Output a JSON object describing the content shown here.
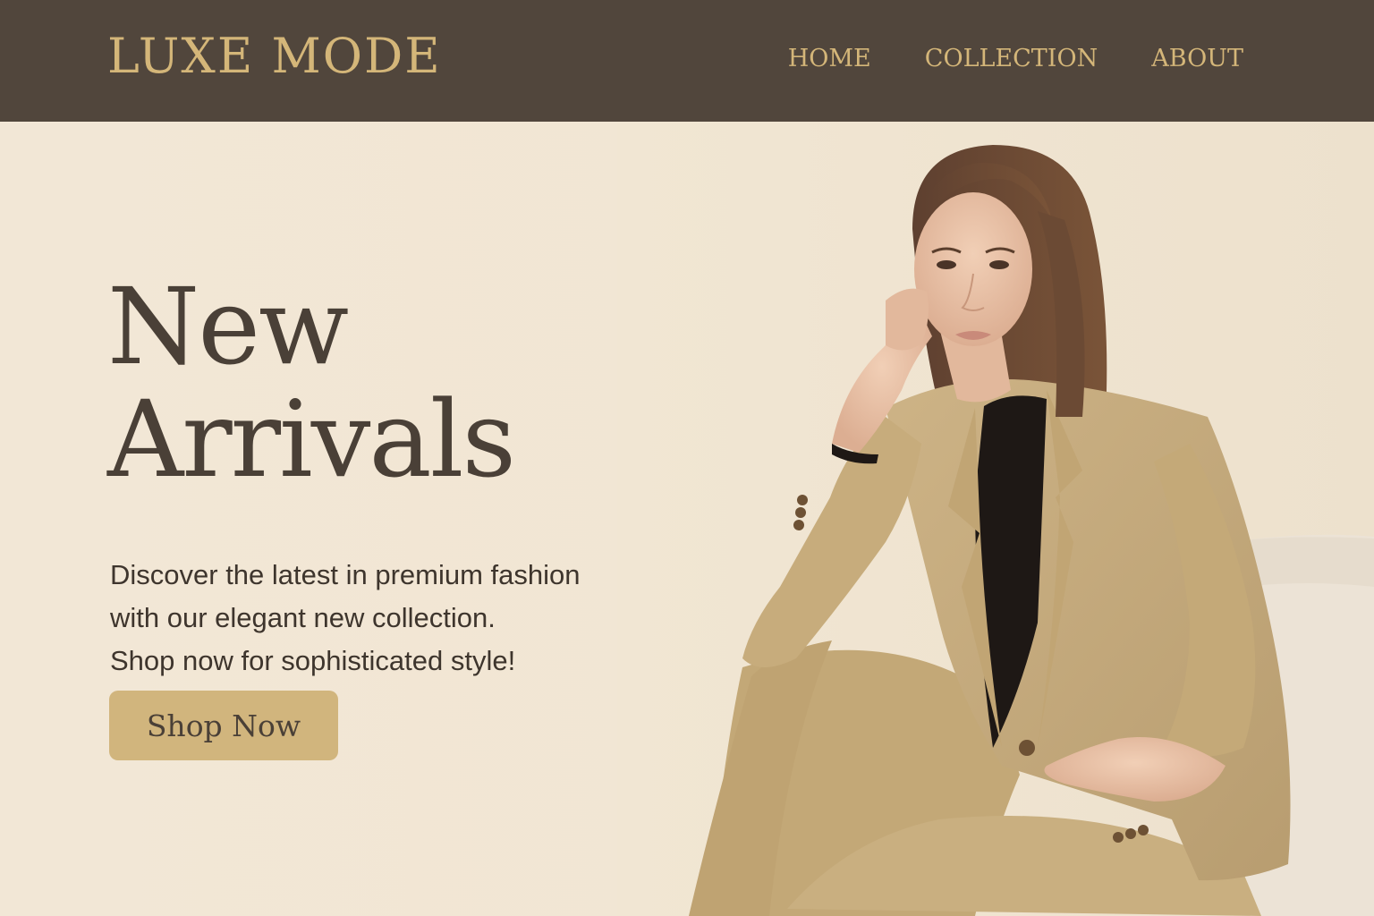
{
  "brand": {
    "name": "LUXE MODE"
  },
  "nav": {
    "items": [
      {
        "label": "HOME"
      },
      {
        "label": "COLLECTION"
      },
      {
        "label": "ABOUT"
      }
    ]
  },
  "hero": {
    "title_line1": "New",
    "title_line2": "Arrivals",
    "description_lines": [
      "Discover the latest in premium fashion",
      "with our elegant new collection.",
      "Shop now for sophisticated style!"
    ],
    "cta_label": "Shop Now",
    "image_icon": "fashion-model-photo"
  },
  "colors": {
    "header_bg": "#51463c",
    "brand_gold": "#d4b679",
    "page_bg": "#f2e7d6",
    "button_bg": "#d1b57d",
    "heading_text": "#4a4037",
    "suit_beige": "#c8ae80"
  }
}
